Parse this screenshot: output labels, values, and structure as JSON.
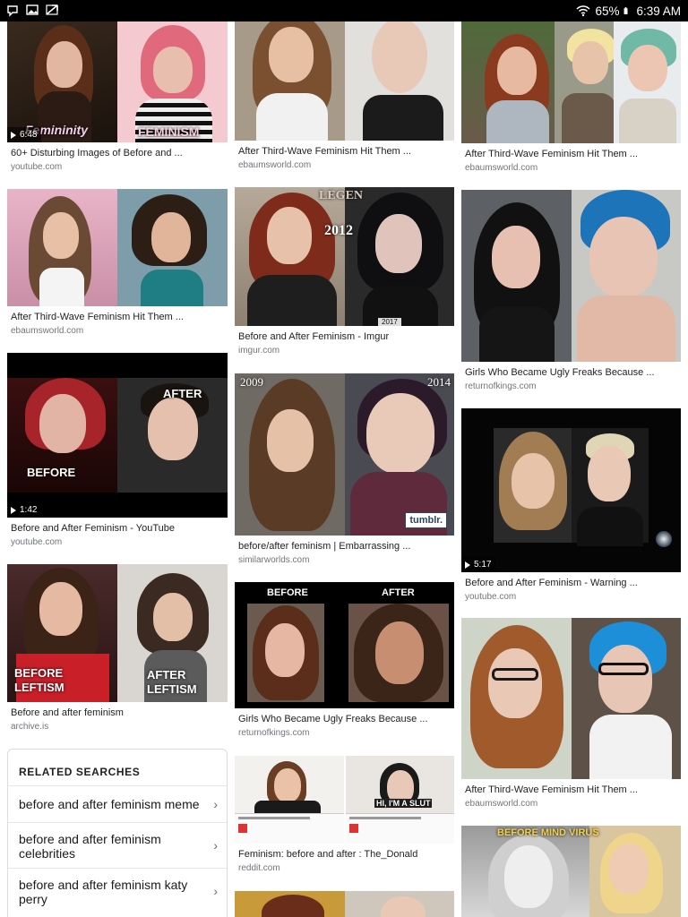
{
  "status_bar": {
    "battery": "65%",
    "time": "6:39 AM",
    "icons": [
      "hangouts-icon",
      "image-icon",
      "direct-icon",
      "wifi-icon",
      "battery-icon"
    ]
  },
  "results": {
    "col1": [
      {
        "caption": "60+ Disturbing Images of Before and ...",
        "domain": "youtube.com",
        "overlay_left": "Femininity",
        "overlay_right": "FEMINISM",
        "duration": "6:48"
      },
      {
        "caption": "After Third-Wave Feminism Hit Them ...",
        "domain": "ebaumsworld.com"
      },
      {
        "caption": "Before and After Feminism - YouTube",
        "domain": "youtube.com",
        "overlay_left": "BEFORE",
        "overlay_right": "AFTER",
        "duration": "1:42"
      },
      {
        "caption": "Before and after feminism",
        "domain": "archive.is",
        "overlay_left": "BEFORE LEFTISM",
        "overlay_right": "AFTER LEFTISM"
      }
    ],
    "col2": [
      {
        "caption": "After Third-Wave Feminism Hit Them ...",
        "domain": "ebaumsworld.com"
      },
      {
        "caption": "Before and After Feminism - Imgur",
        "domain": "imgur.com",
        "overlay_left": "2012",
        "overlay_right": "2017",
        "overlay_top": "LEGEN"
      },
      {
        "caption": "before/after feminism | Embarrassing ...",
        "domain": "similarworlds.com",
        "overlay_left": "2009",
        "overlay_right": "2014",
        "watermark": "tumblr."
      },
      {
        "caption": "Girls Who Became Ugly Freaks Because ...",
        "domain": "returnofkings.com",
        "overlay_left": "BEFORE",
        "overlay_right": "AFTER"
      },
      {
        "caption": "Feminism: before and after : The_Donald",
        "domain": "reddit.com",
        "overlay_right": "HI, I'M A SLUT"
      }
    ],
    "col3": [
      {
        "caption": "After Third-Wave Feminism Hit Them ...",
        "domain": "ebaumsworld.com"
      },
      {
        "caption": "Girls Who Became Ugly Freaks Because ...",
        "domain": "returnofkings.com"
      },
      {
        "caption": "Before and After Feminism - Warning ...",
        "domain": "youtube.com",
        "duration": "5:17"
      },
      {
        "caption": "After Third-Wave Feminism Hit Them ...",
        "domain": "ebaumsworld.com"
      },
      {
        "overlay_top": "BEFORE MIND VIRUS"
      }
    ]
  },
  "related": {
    "heading": "RELATED SEARCHES",
    "items": [
      "before and after feminism meme",
      "before and after feminism celebrities",
      "before and after feminism katy perry"
    ],
    "chevron": "›"
  },
  "colors": {
    "caption": "#222222",
    "domain": "#70757a",
    "status_bar": "#000000",
    "border": "#dadce0"
  }
}
